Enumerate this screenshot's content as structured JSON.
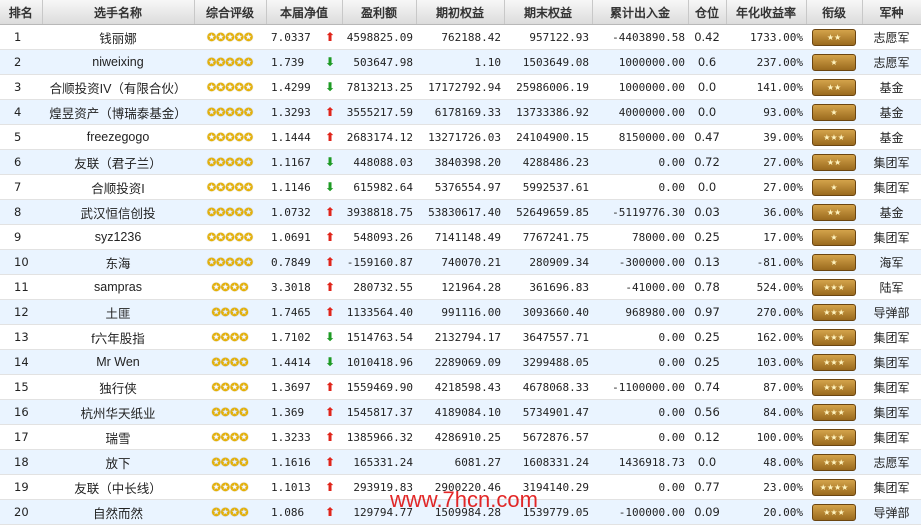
{
  "headers": [
    "排名",
    "选手名称",
    "综合评级",
    "本届净值",
    "盈利额",
    "期初权益",
    "期末权益",
    "累计出入金",
    "仓位",
    "年化收益率",
    "衔级",
    "军种"
  ],
  "watermark": "www.7hcn.com",
  "colors": {
    "up": "#e0251b",
    "down": "#1e9a24",
    "star": "#e8b200",
    "row_alt": "#eaf4ff"
  },
  "rows": [
    {
      "rank": "1",
      "name": "钱丽娜",
      "stars": "✪✪✪✪✪",
      "nav": "7.0337",
      "dir": "up",
      "profit": "4598825.09",
      "start": "762188.42",
      "end": "957122.93",
      "flow": "-4403890.58",
      "pos": "0.42",
      "annual": "1733.00%",
      "rank_badge": "★★",
      "army": "志愿军"
    },
    {
      "rank": "2",
      "name": "niweixing",
      "stars": "✪✪✪✪✪",
      "nav": "1.739",
      "dir": "down",
      "profit": "503647.98",
      "start": "1.10",
      "end": "1503649.08",
      "flow": "1000000.00",
      "pos": "0.6",
      "annual": "237.00%",
      "rank_badge": "★",
      "army": "志愿军"
    },
    {
      "rank": "3",
      "name": "合顺投资IV（有限合伙）",
      "stars": "✪✪✪✪✪",
      "nav": "1.4299",
      "dir": "down",
      "profit": "7813213.25",
      "start": "17172792.94",
      "end": "25986006.19",
      "flow": "1000000.00",
      "pos": "0.0",
      "annual": "141.00%",
      "rank_badge": "★★",
      "army": "基金"
    },
    {
      "rank": "4",
      "name": "煌昱资产（博瑞泰基金）",
      "stars": "✪✪✪✪✪",
      "nav": "1.3293",
      "dir": "up",
      "profit": "3555217.59",
      "start": "6178169.33",
      "end": "13733386.92",
      "flow": "4000000.00",
      "pos": "0.0",
      "annual": "93.00%",
      "rank_badge": "★",
      "army": "基金"
    },
    {
      "rank": "5",
      "name": "freezegogo",
      "stars": "✪✪✪✪✪",
      "nav": "1.1444",
      "dir": "up",
      "profit": "2683174.12",
      "start": "13271726.03",
      "end": "24104900.15",
      "flow": "8150000.00",
      "pos": "0.47",
      "annual": "39.00%",
      "rank_badge": "★★★",
      "army": "基金"
    },
    {
      "rank": "6",
      "name": "友联（君子兰）",
      "stars": "✪✪✪✪✪",
      "nav": "1.1167",
      "dir": "down",
      "profit": "448088.03",
      "start": "3840398.20",
      "end": "4288486.23",
      "flow": "0.00",
      "pos": "0.72",
      "annual": "27.00%",
      "rank_badge": "★★",
      "army": "集团军"
    },
    {
      "rank": "7",
      "name": "合顺投资I",
      "stars": "✪✪✪✪✪",
      "nav": "1.1146",
      "dir": "down",
      "profit": "615982.64",
      "start": "5376554.97",
      "end": "5992537.61",
      "flow": "0.00",
      "pos": "0.0",
      "annual": "27.00%",
      "rank_badge": "★",
      "army": "集团军"
    },
    {
      "rank": "8",
      "name": "武汉恒信创投",
      "stars": "✪✪✪✪✪",
      "nav": "1.0732",
      "dir": "up",
      "profit": "3938818.75",
      "start": "53830617.40",
      "end": "52649659.85",
      "flow": "-5119776.30",
      "pos": "0.03",
      "annual": "36.00%",
      "rank_badge": "★★",
      "army": "基金"
    },
    {
      "rank": "9",
      "name": "syz1236",
      "stars": "✪✪✪✪✪",
      "nav": "1.0691",
      "dir": "up",
      "profit": "548093.26",
      "start": "7141148.49",
      "end": "7767241.75",
      "flow": "78000.00",
      "pos": "0.25",
      "annual": "17.00%",
      "rank_badge": "★",
      "army": "集团军"
    },
    {
      "rank": "10",
      "name": "东海",
      "stars": "✪✪✪✪✪",
      "nav": "0.7849",
      "dir": "up",
      "profit": "-159160.87",
      "start": "740070.21",
      "end": "280909.34",
      "flow": "-300000.00",
      "pos": "0.13",
      "annual": "-81.00%",
      "rank_badge": "★",
      "army": "海军"
    },
    {
      "rank": "11",
      "name": "sampras",
      "stars": "✪✪✪✪",
      "nav": "3.3018",
      "dir": "up",
      "profit": "280732.55",
      "start": "121964.28",
      "end": "361696.83",
      "flow": "-41000.00",
      "pos": "0.78",
      "annual": "524.00%",
      "rank_badge": "★★★",
      "army": "陆军"
    },
    {
      "rank": "12",
      "name": "土匪",
      "stars": "✪✪✪✪",
      "nav": "1.7465",
      "dir": "up",
      "profit": "1133564.40",
      "start": "991116.00",
      "end": "3093660.40",
      "flow": "968980.00",
      "pos": "0.97",
      "annual": "270.00%",
      "rank_badge": "★★★",
      "army": "导弹部"
    },
    {
      "rank": "13",
      "name": "f六年股指",
      "stars": "✪✪✪✪",
      "nav": "1.7102",
      "dir": "down",
      "profit": "1514763.54",
      "start": "2132794.17",
      "end": "3647557.71",
      "flow": "0.00",
      "pos": "0.25",
      "annual": "162.00%",
      "rank_badge": "★★★",
      "army": "集团军"
    },
    {
      "rank": "14",
      "name": "Mr Wen",
      "stars": "✪✪✪✪",
      "nav": "1.4414",
      "dir": "down",
      "profit": "1010418.96",
      "start": "2289069.09",
      "end": "3299488.05",
      "flow": "0.00",
      "pos": "0.25",
      "annual": "103.00%",
      "rank_badge": "★★★",
      "army": "集团军"
    },
    {
      "rank": "15",
      "name": "独行侠",
      "stars": "✪✪✪✪",
      "nav": "1.3697",
      "dir": "up",
      "profit": "1559469.90",
      "start": "4218598.43",
      "end": "4678068.33",
      "flow": "-1100000.00",
      "pos": "0.74",
      "annual": "87.00%",
      "rank_badge": "★★★",
      "army": "集团军"
    },
    {
      "rank": "16",
      "name": "杭州华天纸业",
      "stars": "✪✪✪✪",
      "nav": "1.369",
      "dir": "up",
      "profit": "1545817.37",
      "start": "4189084.10",
      "end": "5734901.47",
      "flow": "0.00",
      "pos": "0.56",
      "annual": "84.00%",
      "rank_badge": "★★★",
      "army": "集团军"
    },
    {
      "rank": "17",
      "name": "瑞雪",
      "stars": "✪✪✪✪",
      "nav": "1.3233",
      "dir": "up",
      "profit": "1385966.32",
      "start": "4286910.25",
      "end": "5672876.57",
      "flow": "0.00",
      "pos": "0.12",
      "annual": "100.00%",
      "rank_badge": "★★★",
      "army": "集团军"
    },
    {
      "rank": "18",
      "name": "放下",
      "stars": "✪✪✪✪",
      "nav": "1.1616",
      "dir": "up",
      "profit": "165331.24",
      "start": "6081.27",
      "end": "1608331.24",
      "flow": "1436918.73",
      "pos": "0.0",
      "annual": "48.00%",
      "rank_badge": "★★★",
      "army": "志愿军"
    },
    {
      "rank": "19",
      "name": "友联（中长线）",
      "stars": "✪✪✪✪",
      "nav": "1.1013",
      "dir": "up",
      "profit": "293919.83",
      "start": "2900220.46",
      "end": "3194140.29",
      "flow": "0.00",
      "pos": "0.77",
      "annual": "23.00%",
      "rank_badge": "★★★★",
      "army": "集团军"
    },
    {
      "rank": "20",
      "name": "自然而然",
      "stars": "✪✪✪✪",
      "nav": "1.086",
      "dir": "up",
      "profit": "129794.77",
      "start": "1509984.28",
      "end": "1539779.05",
      "flow": "-100000.00",
      "pos": "0.09",
      "annual": "20.00%",
      "rank_badge": "★★★",
      "army": "导弹部"
    }
  ]
}
